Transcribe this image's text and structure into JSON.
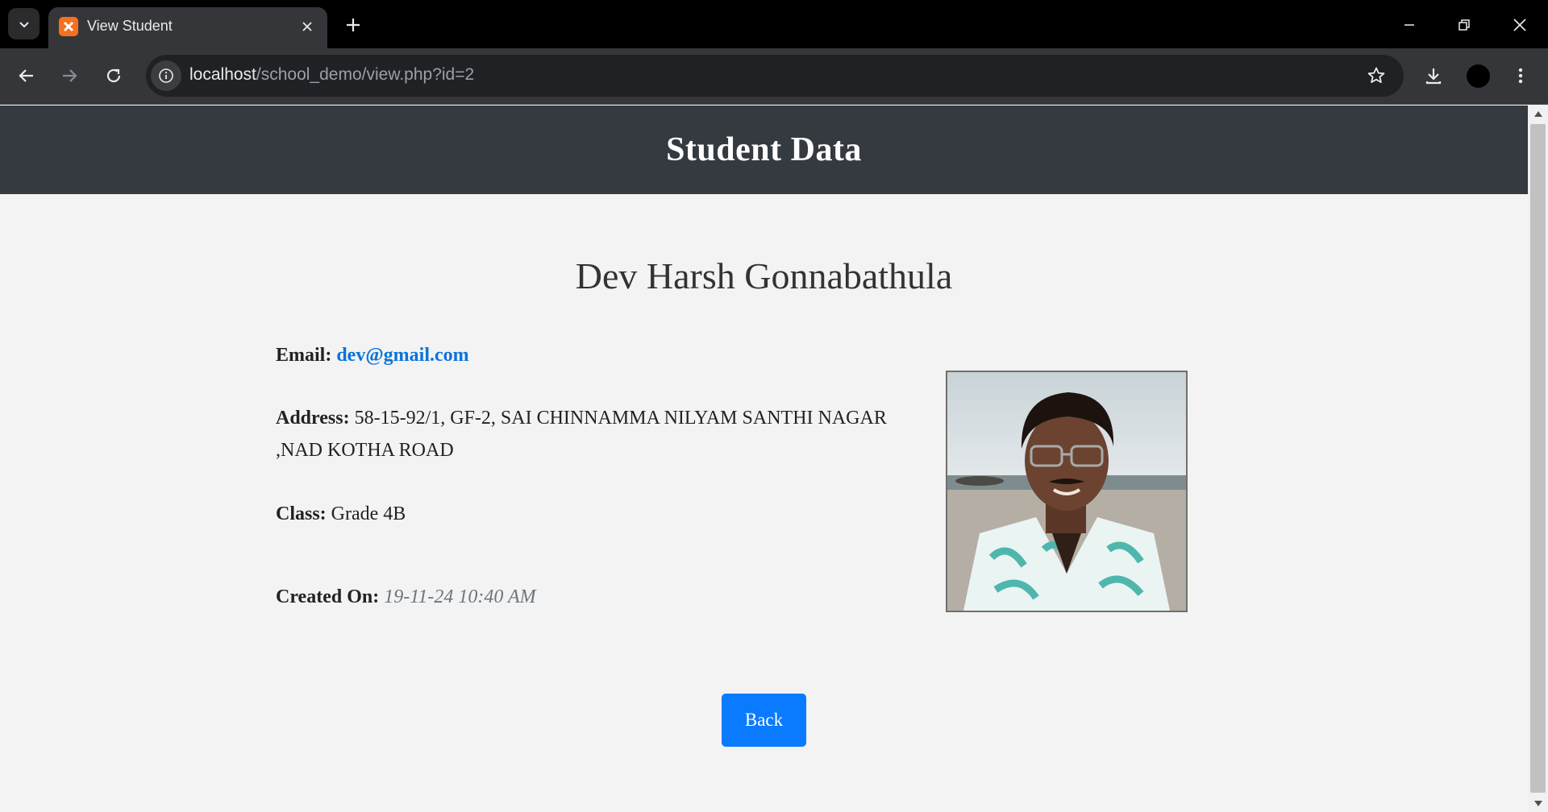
{
  "browser": {
    "tab_title": "View Student",
    "url_host": "localhost",
    "url_path": "/school_demo/view.php?id=2"
  },
  "page": {
    "header_title": "Student Data",
    "student_name": "Dev Harsh Gonnabathula",
    "email_label": "Email:",
    "email_value": "dev@gmail.com",
    "address_label": "Address:",
    "address_value": "58-15-92/1, GF-2, SAI CHINNAMMA NILYAM SANTHI NAGAR ,NAD KOTHA ROAD",
    "class_label": "Class:",
    "class_value": "Grade 4B",
    "created_label": "Created On:",
    "created_value": "19-11-24 10:40 AM",
    "back_label": "Back"
  },
  "colors": {
    "header_bg": "#343a40",
    "link": "#0a74d9",
    "button": "#0a7bff",
    "page_bg": "#f3f3f3"
  }
}
